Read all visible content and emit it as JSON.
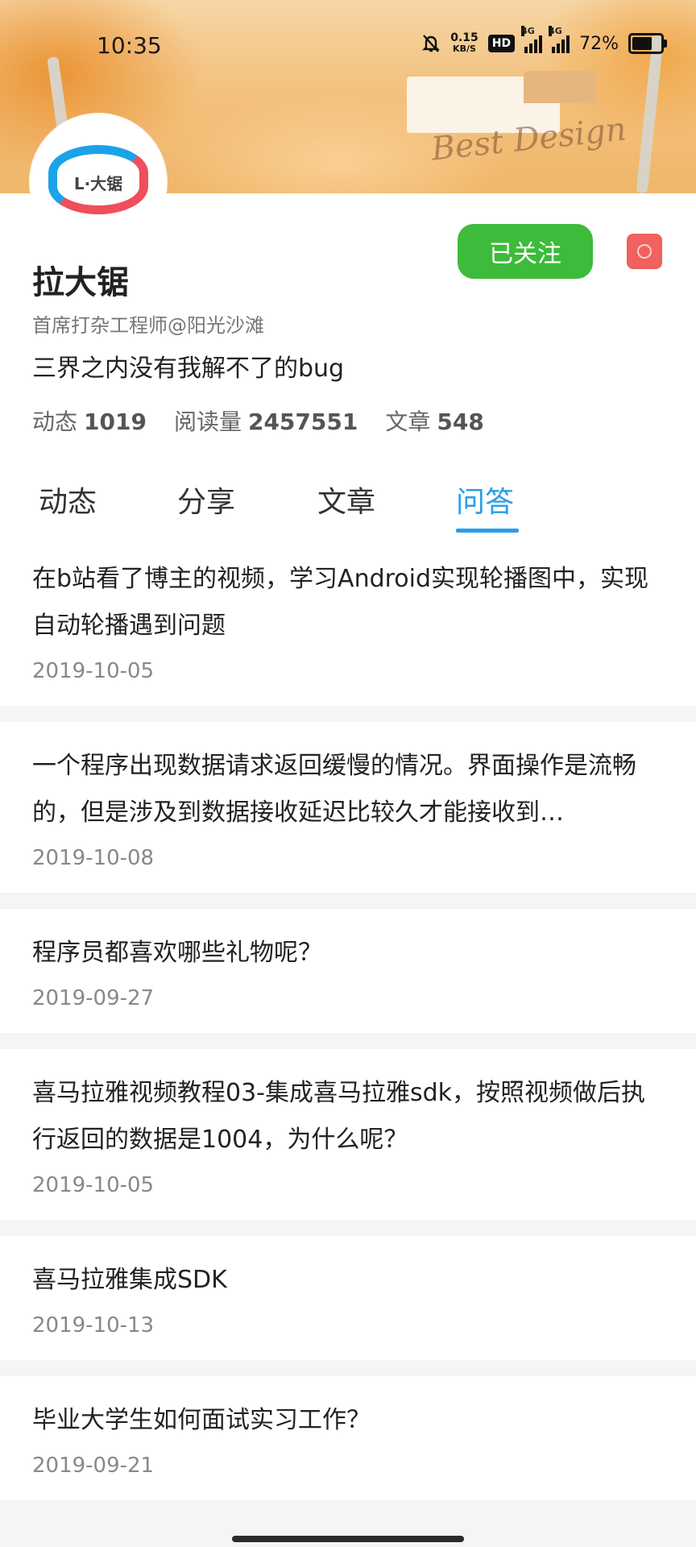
{
  "status_bar": {
    "time": "10:35",
    "net_speed_value": "0.15",
    "net_speed_unit": "KB/S",
    "hd_label": "HD",
    "signal_1_label": "4G",
    "signal_2_label": "4G",
    "battery_percent": "72%",
    "battery_level": 0.72,
    "icons": [
      "mute-bell-icon",
      "hd-icon",
      "signal-4g-icon",
      "signal-4g-icon",
      "battery-icon"
    ]
  },
  "banner": {
    "script_text": "Best Design"
  },
  "profile": {
    "avatar_text": "L·大锯",
    "name": "拉大锯",
    "title": "首席打杂工程师@阳光沙滩",
    "bio": "三界之内没有我解不了的bug",
    "follow_label": "已关注",
    "stats": [
      {
        "label": "动态",
        "value": "1019"
      },
      {
        "label": "阅读量",
        "value": "2457551"
      },
      {
        "label": "文章",
        "value": "548"
      }
    ]
  },
  "tabs": [
    {
      "label": "动态",
      "active": false
    },
    {
      "label": "分享",
      "active": false
    },
    {
      "label": "文章",
      "active": false
    },
    {
      "label": "问答",
      "active": true
    }
  ],
  "questions": [
    {
      "title": "在b站看了博主的视频，学习Android实现轮播图中，实现自动轮播遇到问题",
      "date": "2019-10-05"
    },
    {
      "title": "一个程序出现数据请求返回缓慢的情况。界面操作是流畅的，但是涉及到数据接收延迟比较久才能接收到…",
      "date": "2019-10-08"
    },
    {
      "title": "程序员都喜欢哪些礼物呢？",
      "date": "2019-09-27"
    },
    {
      "title": "喜马拉雅视频教程03-集成喜马拉雅sdk，按照视频做后执行返回的数据是1004，为什么呢？",
      "date": "2019-10-05"
    },
    {
      "title": "喜马拉雅集成SDK",
      "date": "2019-10-13"
    },
    {
      "title": "毕业大学生如何面试实习工作？",
      "date": "2019-09-21"
    }
  ],
  "colors": {
    "accent": "#2a9de6",
    "follow_green": "#3dbb3a",
    "more_red": "#f0615f"
  }
}
